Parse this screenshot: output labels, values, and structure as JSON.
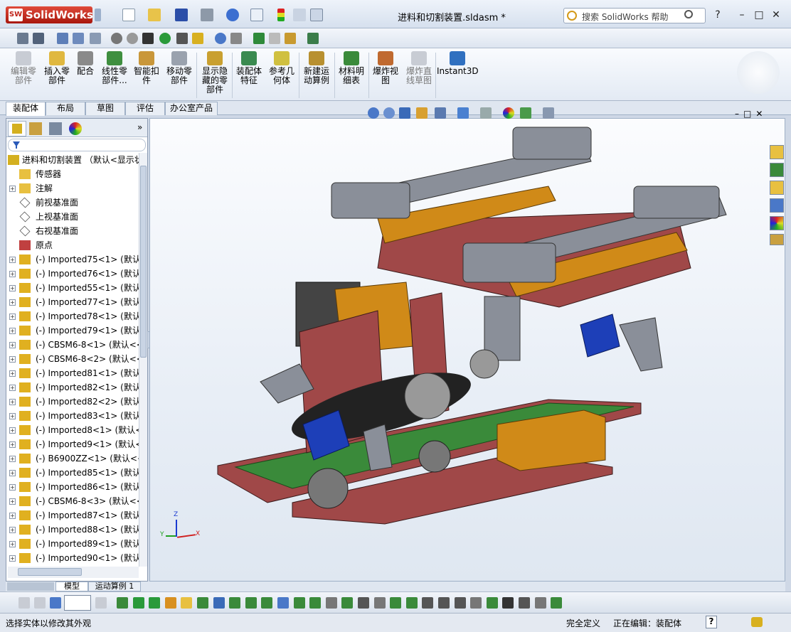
{
  "window": {
    "app_name": "SolidWorks",
    "logo_badge": "SW",
    "doc_title": "进料和切割装置.sldasm *",
    "search_placeholder": "搜索 SolidWorks 帮助",
    "help": "?",
    "min": "–",
    "max": "□",
    "close": "✕"
  },
  "command_manager": {
    "buttons": [
      {
        "label": "编辑零\n部件",
        "icon": "edit-component-icon"
      },
      {
        "label": "插入零\n部件",
        "icon": "insert-component-icon"
      },
      {
        "label": "配合",
        "icon": "mate-icon"
      },
      {
        "label": "线性零\n部件...",
        "icon": "linear-pattern-icon"
      },
      {
        "label": "智能扣\n件",
        "icon": "smart-fastener-icon"
      },
      {
        "label": "移动零\n部件",
        "icon": "move-component-icon"
      },
      {
        "label": "显示隐\n藏的零\n部件",
        "icon": "show-hidden-icon"
      },
      {
        "label": "装配体\n特征",
        "icon": "assembly-feature-icon"
      },
      {
        "label": "参考几\n何体",
        "icon": "reference-geometry-icon"
      },
      {
        "label": "新建运\n动算例",
        "icon": "motion-study-icon"
      },
      {
        "label": "材料明\n细表",
        "icon": "bom-icon"
      },
      {
        "label": "爆炸视\n图",
        "icon": "exploded-view-icon"
      },
      {
        "label": "爆炸直\n线草图",
        "icon": "explode-line-icon"
      },
      {
        "label": "Instant3D",
        "icon": "instant3d-icon"
      }
    ],
    "tabs": [
      "装配体",
      "布局",
      "草图",
      "评估",
      "办公室产品"
    ]
  },
  "tree": {
    "root": "进料和切割装置 （默认<显示状",
    "items": [
      {
        "label": "传感器",
        "kind": "sensor-icon",
        "expand": ""
      },
      {
        "label": "注解",
        "kind": "annotation-icon",
        "expand": "+"
      },
      {
        "label": "前视基准面",
        "kind": "plane-icon",
        "expand": ""
      },
      {
        "label": "上视基准面",
        "kind": "plane-icon",
        "expand": ""
      },
      {
        "label": "右视基准面",
        "kind": "plane-icon",
        "expand": ""
      },
      {
        "label": "原点",
        "kind": "origin-icon",
        "expand": ""
      },
      {
        "label": "(-) Imported75<1> (默认",
        "kind": "part-icon",
        "expand": "+"
      },
      {
        "label": "(-) Imported76<1> (默认",
        "kind": "part-icon",
        "expand": "+"
      },
      {
        "label": "(-) Imported55<1> (默认",
        "kind": "part-icon",
        "expand": "+"
      },
      {
        "label": "(-) Imported77<1> (默认",
        "kind": "part-icon",
        "expand": "+"
      },
      {
        "label": "(-) Imported78<1> (默认",
        "kind": "part-icon",
        "expand": "+"
      },
      {
        "label": "(-) Imported79<1> (默认",
        "kind": "part-icon",
        "expand": "+"
      },
      {
        "label": "(-) CBSM6-8<1> (默认<<",
        "kind": "part-icon",
        "expand": "+"
      },
      {
        "label": "(-) CBSM6-8<2> (默认<<",
        "kind": "part-icon",
        "expand": "+"
      },
      {
        "label": "(-) Imported81<1> (默认",
        "kind": "part-icon",
        "expand": "+"
      },
      {
        "label": "(-) Imported82<1> (默认",
        "kind": "part-icon",
        "expand": "+"
      },
      {
        "label": "(-) Imported82<2> (默认",
        "kind": "part-icon",
        "expand": "+"
      },
      {
        "label": "(-) Imported83<1> (默认",
        "kind": "part-icon",
        "expand": "+"
      },
      {
        "label": "(-) Imported8<1> (默认<",
        "kind": "part-icon",
        "expand": "+"
      },
      {
        "label": "(-) Imported9<1> (默认<",
        "kind": "part-icon",
        "expand": "+"
      },
      {
        "label": "(-) B6900ZZ<1> (默认<<",
        "kind": "part-icon",
        "expand": "+"
      },
      {
        "label": "(-) Imported85<1> (默认",
        "kind": "part-icon",
        "expand": "+"
      },
      {
        "label": "(-) Imported86<1> (默认",
        "kind": "part-icon",
        "expand": "+"
      },
      {
        "label": "(-) CBSM6-8<3> (默认<<",
        "kind": "part-icon",
        "expand": "+"
      },
      {
        "label": "(-) Imported87<1> (默认",
        "kind": "part-icon",
        "expand": "+"
      },
      {
        "label": "(-) Imported88<1> (默认",
        "kind": "part-icon",
        "expand": "+"
      },
      {
        "label": "(-) Imported89<1> (默认",
        "kind": "part-icon",
        "expand": "+"
      },
      {
        "label": "(-) Imported90<1> (默认",
        "kind": "part-icon",
        "expand": "+"
      }
    ]
  },
  "bottom_tabs": [
    "模型",
    "运动算例 1"
  ],
  "status": {
    "left": "选择实体以修改其外观",
    "defined": "完全定义",
    "editing": "正在编辑：装配体",
    "help_icon": "?"
  },
  "triad": {
    "x": "X",
    "y": "Y",
    "z": "Z"
  },
  "colors": {
    "part_gray": "#8a8f99",
    "plate_red": "#a04848",
    "belt_green": "#3a8a3a",
    "bracket_orange": "#d08a18",
    "motor_blue": "#1d3fb8"
  }
}
